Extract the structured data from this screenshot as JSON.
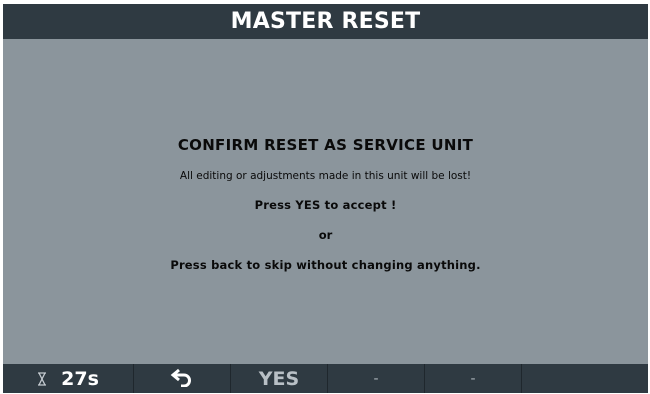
{
  "header": {
    "title": "MASTER RESET"
  },
  "message": {
    "title": "CONFIRM RESET AS SERVICE UNIT",
    "warning": "All editing or adjustments made in this unit will be lost!",
    "accept": "Press YES to accept !",
    "or": "or",
    "skip": "Press back to skip without changing anything."
  },
  "footer": {
    "timer_icon": "hourglass-icon",
    "timer": "27s",
    "back_icon": "back-arrow-icon",
    "yes": "YES",
    "btn4": "-",
    "btn5": "-"
  },
  "colors": {
    "background": "#8b959c",
    "bar": "#2f3a42"
  }
}
